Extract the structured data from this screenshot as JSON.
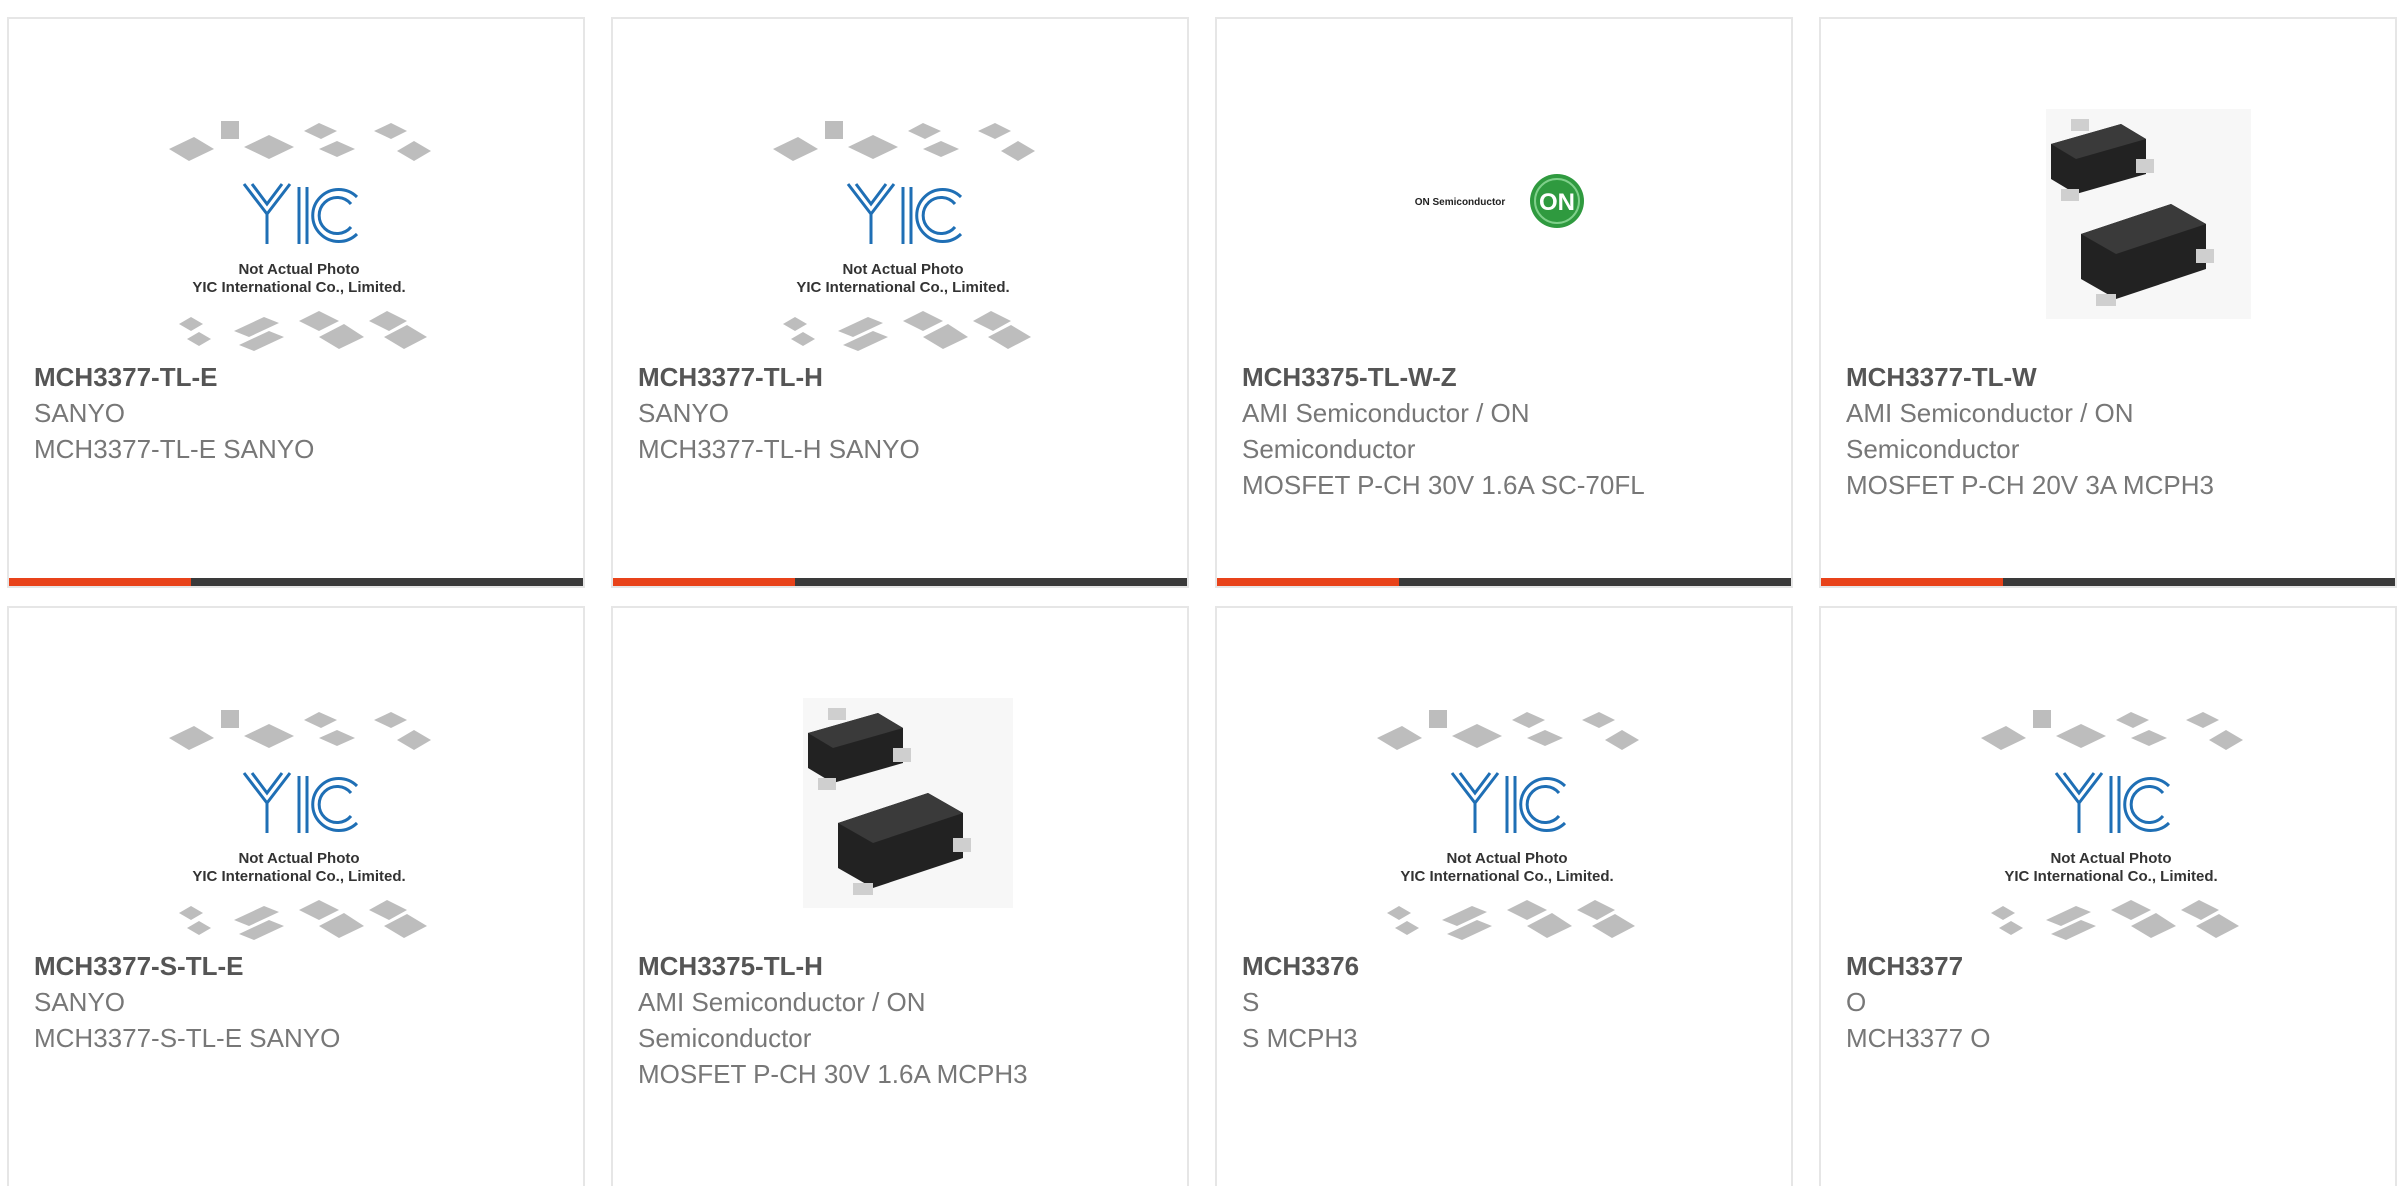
{
  "placeholder": {
    "line1": "Not Actual Photo",
    "line2": "YIC International Co., Limited.",
    "logo": "YIC"
  },
  "on_logo": {
    "text": "ON Semiconductor",
    "badge": "ON"
  },
  "colors": {
    "accent": "#e8431a",
    "bar": "#3a3a3a",
    "border": "#e6e6e6",
    "logo_blue": "#1f6fb5",
    "on_green": "#2f9a3f"
  },
  "products": [
    {
      "part": "MCH3377-TL-E",
      "maker": "SANYO",
      "desc": "MCH3377-TL-E SANYO",
      "image": "yic-placeholder"
    },
    {
      "part": "MCH3377-TL-H",
      "maker": "SANYO",
      "desc": "MCH3377-TL-H SANYO",
      "image": "yic-placeholder"
    },
    {
      "part": "MCH3375-TL-W-Z",
      "maker": "AMI Semiconductor / ON Semiconductor",
      "desc": "MOSFET P-CH 30V 1.6A SC-70FL",
      "image": "on-semiconductor-logo"
    },
    {
      "part": "MCH3377-TL-W",
      "maker": "AMI Semiconductor / ON Semiconductor",
      "desc": "MOSFET P-CH 20V 3A MCPH3",
      "image": "chip-photo"
    },
    {
      "part": "MCH3377-S-TL-E",
      "maker": "SANYO",
      "desc": "MCH3377-S-TL-E SANYO",
      "image": "yic-placeholder"
    },
    {
      "part": "MCH3375-TL-H",
      "maker": "AMI Semiconductor / ON Semiconductor",
      "desc": "MOSFET P-CH 30V 1.6A MCPH3",
      "image": "chip-photo"
    },
    {
      "part": "MCH3376",
      "maker": "S",
      "desc": "S MCPH3",
      "image": "yic-placeholder"
    },
    {
      "part": "MCH3377",
      "maker": "O",
      "desc": "MCH3377 O",
      "image": "yic-placeholder"
    }
  ]
}
